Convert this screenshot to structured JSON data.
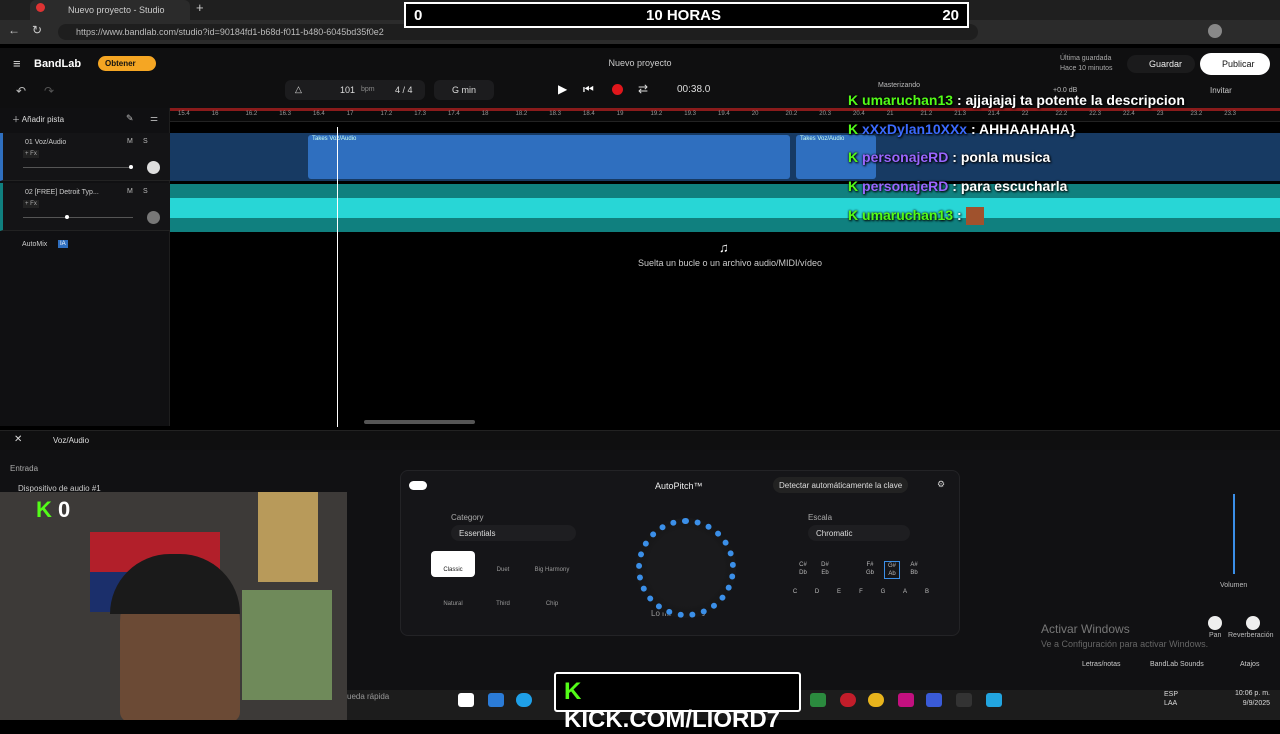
{
  "browser": {
    "tab_title": "Nuevo proyecto - Studio",
    "url": "https://www.bandlab.com/studio?id=90184fd1-b68d-f011-b480-6045bd35f0e2"
  },
  "overlay_counter": {
    "left": "0",
    "center": "10 HORAS",
    "right": "20"
  },
  "header": {
    "logo": "BandLab",
    "obtener": "Obtener",
    "title": "Nuevo proyecto",
    "saved_line1": "Última guardada",
    "saved_line2": "Hace 10 minutos",
    "guardar": "Guardar",
    "publicar": "Publicar",
    "masterizando": "Masterizando",
    "invitar": "Invitar"
  },
  "transport": {
    "bpm": "101",
    "bpm_unit": "bpm",
    "time_sig": "4 / 4",
    "key": "G min",
    "time": "00:38.0",
    "gain": "+0.0 dB"
  },
  "ruler": [
    "15.4",
    "16",
    "16.2",
    "16.3",
    "16.4",
    "17",
    "17.2",
    "17.3",
    "17.4",
    "18",
    "18.2",
    "18.3",
    "18.4",
    "19",
    "19.2",
    "19.3",
    "19.4",
    "20",
    "20.2",
    "20.3",
    "20.4",
    "21",
    "21.2",
    "21.3",
    "21.4",
    "22",
    "22.2",
    "22.3",
    "22.4",
    "23",
    "23.2",
    "23.3"
  ],
  "tracks": {
    "add_track": "Añadir pista",
    "t1_name": "01  Voz/Audio",
    "t2_name": "02  [FREE] Detroit Typ...",
    "fx": "+ Fx",
    "m": "M",
    "s": "S",
    "automix": "AutoMix",
    "automix_badge": "IA",
    "clip_label": "Takes  Voz/Audio",
    "clip_label2": "Takes  Voz/Audio",
    "drop_text": "Suelta un bucle o un archivo audio/MIDI/vídeo"
  },
  "panel": {
    "track": "Voz/Audio",
    "entrada": "Entrada",
    "device": "Dispositivo de audio #1",
    "autopitch": "AutoPitch™",
    "detect": "Detectar automáticamente la clave",
    "category_label": "Category",
    "category_value": "Essentials",
    "escala_label": "Escala",
    "escala_value": "Chromatic",
    "presets": [
      "Classic",
      "Duet",
      "Big Harmony",
      "Natural",
      "Third",
      "Chip"
    ],
    "intensity": "Lo más intenso",
    "sharp_keys": [
      "C#\nDb",
      "D#\nEb",
      "F#\nGb",
      "G#\nAb",
      "A#\nBb"
    ],
    "keys": [
      "C",
      "D",
      "E",
      "F",
      "G",
      "A",
      "B"
    ],
    "volumen": "Volumen",
    "pan": "Pan",
    "reverb": "Reverberación",
    "letras": "Letras/notas",
    "sounds": "BandLab Sounds",
    "atajos": "Atajos"
  },
  "windows_watermark": {
    "line1": "Activar Windows",
    "line2": "Ve a Configuración para activar Windows."
  },
  "chat": [
    {
      "user": "umaruchan13",
      "msg": ": ajjajajaj ta potente la descripcion",
      "color": "user"
    },
    {
      "user": "xXxDylan10XXx",
      "msg": ": AHHAAHAHA}",
      "color": "blue"
    },
    {
      "user": "personajeRD",
      "msg": ": ponla musica",
      "color": "purple"
    },
    {
      "user": "personajeRD",
      "msg": ": para escucharla",
      "color": "purple"
    },
    {
      "user": "umaruchan13",
      "msg": ":",
      "color": "user"
    }
  ],
  "webcam": {
    "kick_count": "0"
  },
  "taskbar": {
    "search": "ueda rápida",
    "kick_banner": "KICK.COM/LIORD7",
    "lang1": "ESP",
    "lang2": "LAA",
    "time": "10:06 p. m.",
    "date": "9/9/2025"
  },
  "colors": {
    "accent": "#f5a623",
    "kick": "#53fc18",
    "track1": "#2f6fbf",
    "track2": "#10807f",
    "record": "#e0161b"
  }
}
